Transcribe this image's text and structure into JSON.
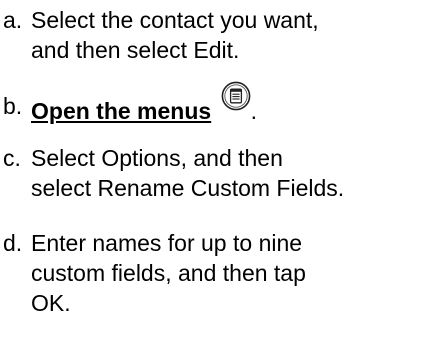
{
  "steps": [
    {
      "marker": "a.",
      "lines": [
        "Select the contact you want,",
        "and then select Edit."
      ]
    },
    {
      "marker": "b.",
      "link_text": "Open the menus",
      "icon": "menu-icon",
      "trailing": "."
    },
    {
      "marker": "c.",
      "lines": [
        "Select Options, and then",
        "select Rename Custom Fields."
      ]
    },
    {
      "marker": "d.",
      "lines": [
        "Enter names for up to nine",
        "custom fields, and then tap",
        "OK."
      ]
    }
  ]
}
